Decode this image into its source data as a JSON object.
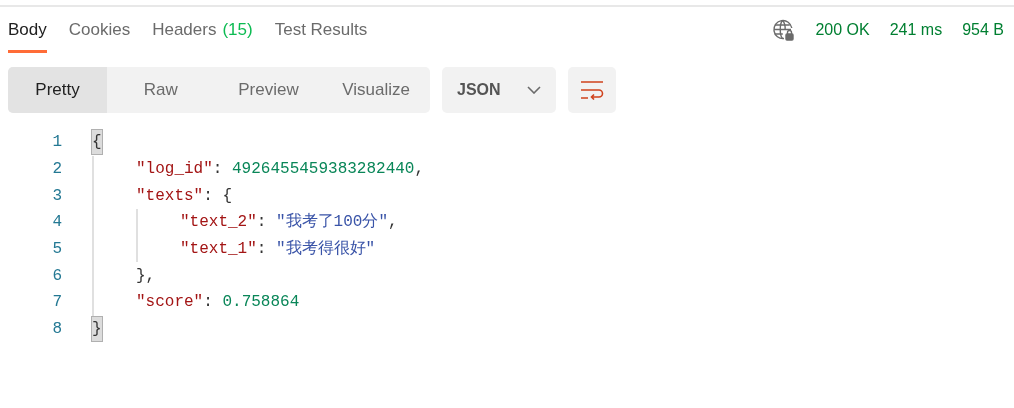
{
  "tabs": [
    {
      "label": "Body",
      "selected": true
    },
    {
      "label": "Cookies",
      "selected": false
    },
    {
      "label": "Headers",
      "count": "(15)",
      "selected": false
    },
    {
      "label": "Test Results",
      "selected": false
    }
  ],
  "status": {
    "code": "200 OK",
    "time": "241 ms",
    "size": "954 B"
  },
  "views": [
    {
      "label": "Pretty",
      "selected": true
    },
    {
      "label": "Raw",
      "selected": false
    },
    {
      "label": "Preview",
      "selected": false
    },
    {
      "label": "Visualize",
      "selected": false
    }
  ],
  "format": "JSON",
  "code": [
    {
      "number": "1",
      "tokens": [
        {
          "kind": "brace-match",
          "text": "{"
        }
      ],
      "children": [
        {
          "number": "2",
          "tokens": [
            {
              "kind": "key",
              "text": "\"log_id\""
            },
            {
              "kind": "punct",
              "text": ": "
            },
            {
              "kind": "number",
              "text": "4926455459383282440"
            },
            {
              "kind": "punct",
              "text": ","
            }
          ]
        },
        {
          "number": "3",
          "tokens": [
            {
              "kind": "key",
              "text": "\"texts\""
            },
            {
              "kind": "punct",
              "text": ": {"
            }
          ],
          "children": [
            {
              "number": "4",
              "tokens": [
                {
                  "kind": "key",
                  "text": "\"text_2\""
                },
                {
                  "kind": "punct",
                  "text": ": "
                },
                {
                  "kind": "string",
                  "text": "\"我考了100分\""
                },
                {
                  "kind": "punct",
                  "text": ","
                }
              ]
            },
            {
              "number": "5",
              "tokens": [
                {
                  "kind": "key",
                  "text": "\"text_1\""
                },
                {
                  "kind": "punct",
                  "text": ": "
                },
                {
                  "kind": "string",
                  "text": "\"我考得很好\""
                }
              ]
            }
          ]
        },
        {
          "number": "6",
          "tokens": [
            {
              "kind": "punct",
              "text": "},"
            }
          ]
        },
        {
          "number": "7",
          "tokens": [
            {
              "kind": "key",
              "text": "\"score\""
            },
            {
              "kind": "punct",
              "text": ": "
            },
            {
              "kind": "number",
              "text": "0.758864"
            }
          ]
        }
      ]
    },
    {
      "number": "8",
      "tokens": [
        {
          "kind": "brace-match",
          "text": "}"
        }
      ]
    }
  ]
}
